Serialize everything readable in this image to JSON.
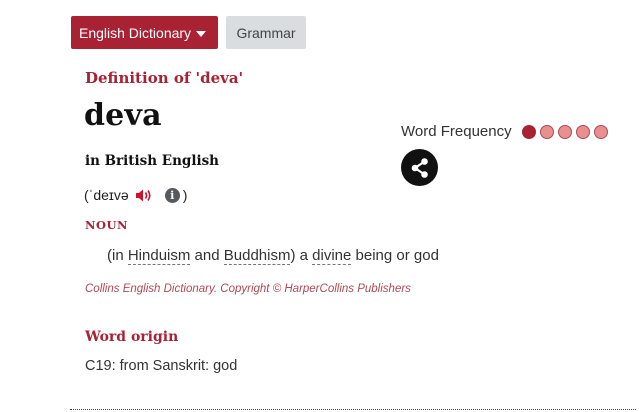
{
  "nav": {
    "dictionary_label": "English Dictionary",
    "grammar_label": "Grammar"
  },
  "entry": {
    "definition_heading": "Definition of 'deva'",
    "headword": "deva",
    "variety": "in British English",
    "pron_open": "(",
    "pronunciation": "ˈdeɪvə",
    "pron_close": ")",
    "info_glyph": "i",
    "part_of_speech": "NOUN",
    "sense": {
      "open": "(in ",
      "term1": "Hinduism",
      "and": " and ",
      "term2": "Buddhism",
      "mid": ") a ",
      "term3": "divine",
      "rest": " being or god"
    },
    "copyright": "Collins English Dictionary. Copyright © HarperCollins Publishers",
    "origin_heading": "Word origin",
    "origin_text": "C19: from Sanskrit: god"
  },
  "frequency": {
    "label": "Word Frequency",
    "level": 1,
    "max": 5
  },
  "colors": {
    "accent": "#a82234",
    "dot_inactive": "#e88f8f",
    "grammar_bg": "#d9dde0"
  },
  "icons": {
    "dropdown": "caret-down-icon",
    "audio": "speaker-icon",
    "info": "info-icon",
    "share": "share-icon"
  }
}
